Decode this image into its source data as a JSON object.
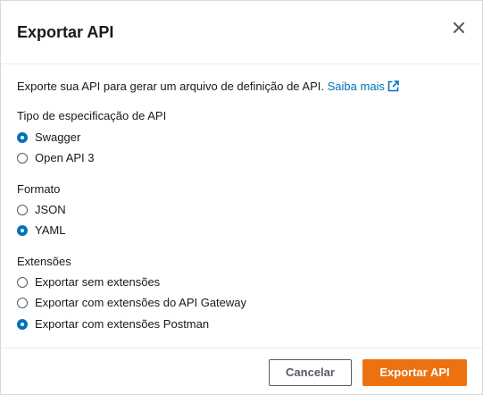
{
  "dialog": {
    "title": "Exportar API",
    "close_icon": "close-icon"
  },
  "description": {
    "text": "Exporte sua API para gerar um arquivo de definição de API.",
    "link_label": "Saiba mais",
    "link_icon": "external-link-icon"
  },
  "spec_type": {
    "label": "Tipo de especificação de API",
    "options": [
      {
        "label": "Swagger",
        "checked": true
      },
      {
        "label": "Open API 3",
        "checked": false
      }
    ]
  },
  "format": {
    "label": "Formato",
    "options": [
      {
        "label": "JSON",
        "checked": false
      },
      {
        "label": "YAML",
        "checked": true
      }
    ]
  },
  "extensions": {
    "label": "Extensões",
    "options": [
      {
        "label": "Exportar sem extensões",
        "checked": false
      },
      {
        "label": "Exportar com extensões do API Gateway",
        "checked": false
      },
      {
        "label": "Exportar com extensões Postman",
        "checked": true
      }
    ]
  },
  "footer": {
    "cancel_label": "Cancelar",
    "submit_label": "Exportar API"
  },
  "colors": {
    "accent": "#0073bb",
    "primary_button": "#ec7211",
    "text": "#16191f"
  }
}
